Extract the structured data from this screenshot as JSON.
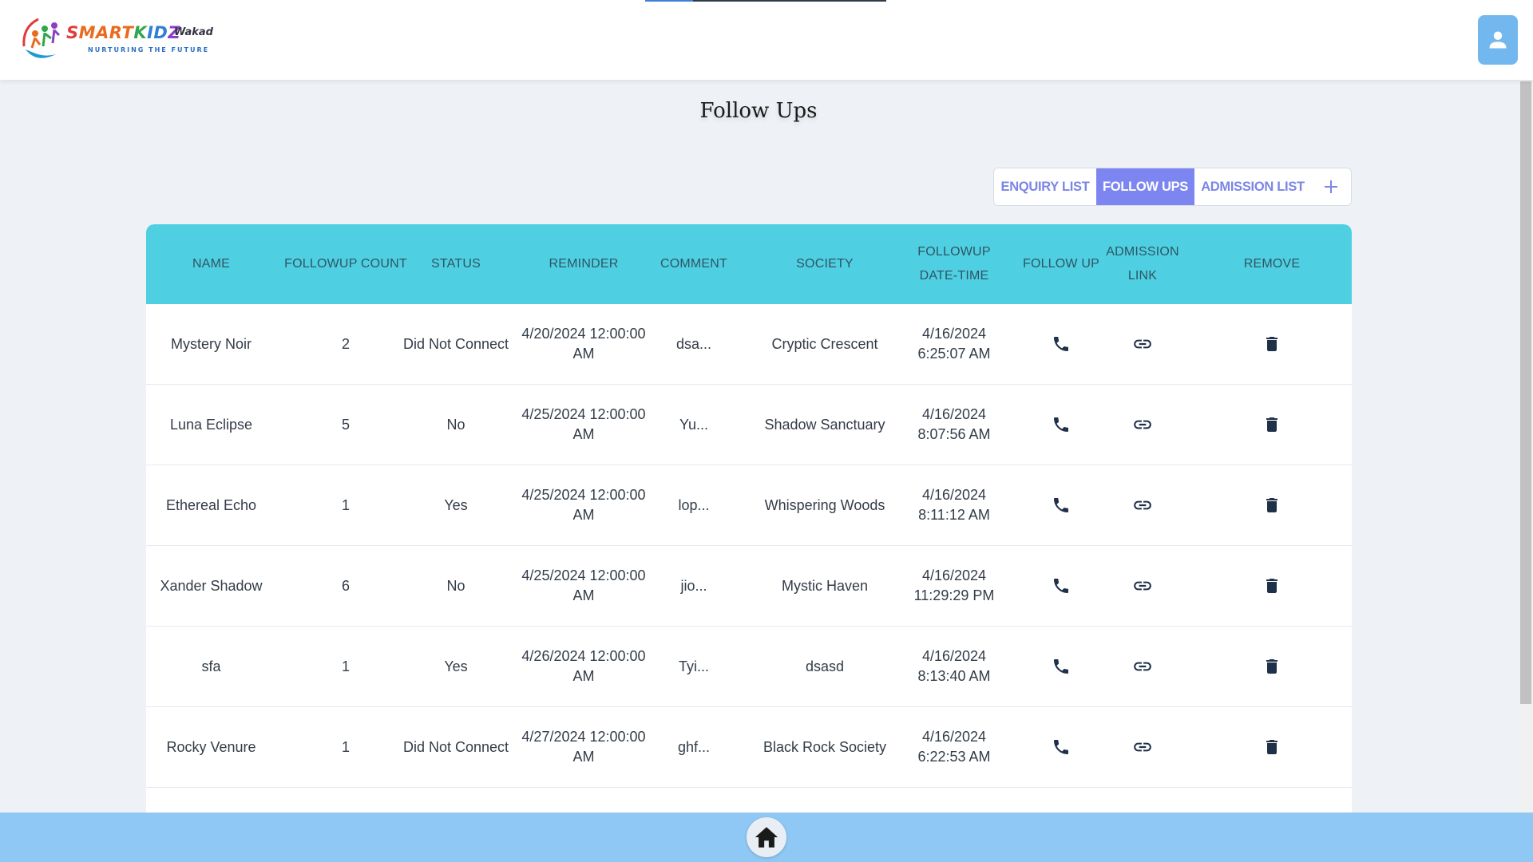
{
  "brand": {
    "name_parts": [
      "S",
      "MART",
      "K",
      "ID",
      "Z"
    ],
    "location": "Wakad",
    "tagline": "NURTURING THE FUTURE"
  },
  "page": {
    "title": "Follow Ups"
  },
  "tabs": [
    {
      "label": "ENQUIRY LIST",
      "active": false
    },
    {
      "label": "FOLLOW UPS",
      "active": true
    },
    {
      "label": "ADMISSION LIST",
      "active": false
    }
  ],
  "table": {
    "columns": [
      {
        "label": "NAME"
      },
      {
        "label": "FOLLOWUP COUNT"
      },
      {
        "label": "STATUS"
      },
      {
        "label": "REMINDER"
      },
      {
        "label": "COMMENT"
      },
      {
        "label": "SOCIETY"
      },
      {
        "label": "FOLLOWUP DATE-TIME"
      },
      {
        "label": "FOLLOW UP"
      },
      {
        "label": "ADMISSION LINK"
      },
      {
        "label": "REMOVE"
      }
    ],
    "rows": [
      {
        "name": "Mystery Noir",
        "count": "2",
        "status": "Did Not Connect",
        "reminder": "4/20/2024 12:00:00 AM",
        "comment": "dsa...",
        "society": "Cryptic Crescent",
        "followup_datetime": "4/16/2024 6:25:07 AM"
      },
      {
        "name": "Luna Eclipse",
        "count": "5",
        "status": "No",
        "reminder": "4/25/2024 12:00:00 AM",
        "comment": "Yu...",
        "society": "Shadow Sanctuary",
        "followup_datetime": "4/16/2024 8:07:56 AM"
      },
      {
        "name": "Ethereal Echo",
        "count": "1",
        "status": "Yes",
        "reminder": "4/25/2024 12:00:00 AM",
        "comment": "lop...",
        "society": "Whispering Woods",
        "followup_datetime": "4/16/2024 8:11:12 AM"
      },
      {
        "name": "Xander Shadow",
        "count": "6",
        "status": "No",
        "reminder": "4/25/2024 12:00:00 AM",
        "comment": "jio...",
        "society": "Mystic Haven",
        "followup_datetime": "4/16/2024 11:29:29 PM"
      },
      {
        "name": "sfa",
        "count": "1",
        "status": "Yes",
        "reminder": "4/26/2024 12:00:00 AM",
        "comment": "Tyi...",
        "society": "dsasd",
        "followup_datetime": "4/16/2024 8:13:40 AM"
      },
      {
        "name": "Rocky Venure",
        "count": "1",
        "status": "Did Not Connect",
        "reminder": "4/27/2024 12:00:00 AM",
        "comment": "ghf...",
        "society": "Black Rock Society",
        "followup_datetime": "4/16/2024 6:22:53 AM"
      }
    ]
  },
  "icons": {
    "user": "user-icon",
    "add": "plus-icon",
    "followup": "phone-icon",
    "admission": "link-icon",
    "remove": "trash-icon",
    "home": "home-icon"
  },
  "colors": {
    "header_bg": "#4fd0e2",
    "tab_active": "#7d86f0",
    "tab_text": "#7a86e6",
    "bottom_bar": "#8fc8f5",
    "user_button": "#73b7ef"
  }
}
